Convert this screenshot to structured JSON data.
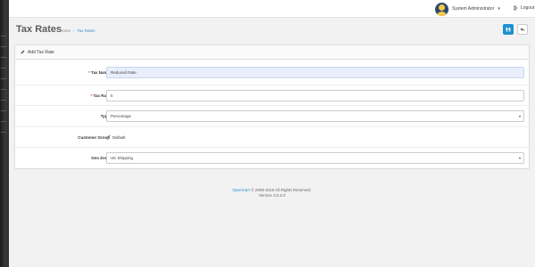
{
  "header": {
    "user_name": "System Administrator",
    "caret": "▾",
    "logout_label": "Logout"
  },
  "page": {
    "title": "Tax Rates",
    "breadcrumb": [
      "Home",
      "Tax Rates"
    ]
  },
  "panel": {
    "title": "Add Tax Rate"
  },
  "form": {
    "tax_name": {
      "label": "Tax Name",
      "value": "Reduced Rate"
    },
    "tax_rate": {
      "label": "Tax Rate",
      "value": "5"
    },
    "type": {
      "label": "Type",
      "value": "Percentage"
    },
    "customer_group": {
      "label": "Customer Group",
      "option": "Default",
      "checked": true
    },
    "geo_zone": {
      "label": "Geo Zone",
      "value": "UK Shipping"
    }
  },
  "footer": {
    "link": "OpenCart",
    "copyright": "© 2009-2019 All Rights Reserved.",
    "version": "Version 3.0.2.0"
  },
  "colors": {
    "primary": "#1e91cf",
    "required": "#ee3333",
    "highlight": "#e8eefb"
  },
  "icons": {
    "save": "save-icon",
    "back": "reply-icon",
    "panel": "pencil-icon",
    "logout": "sign-out-icon"
  }
}
